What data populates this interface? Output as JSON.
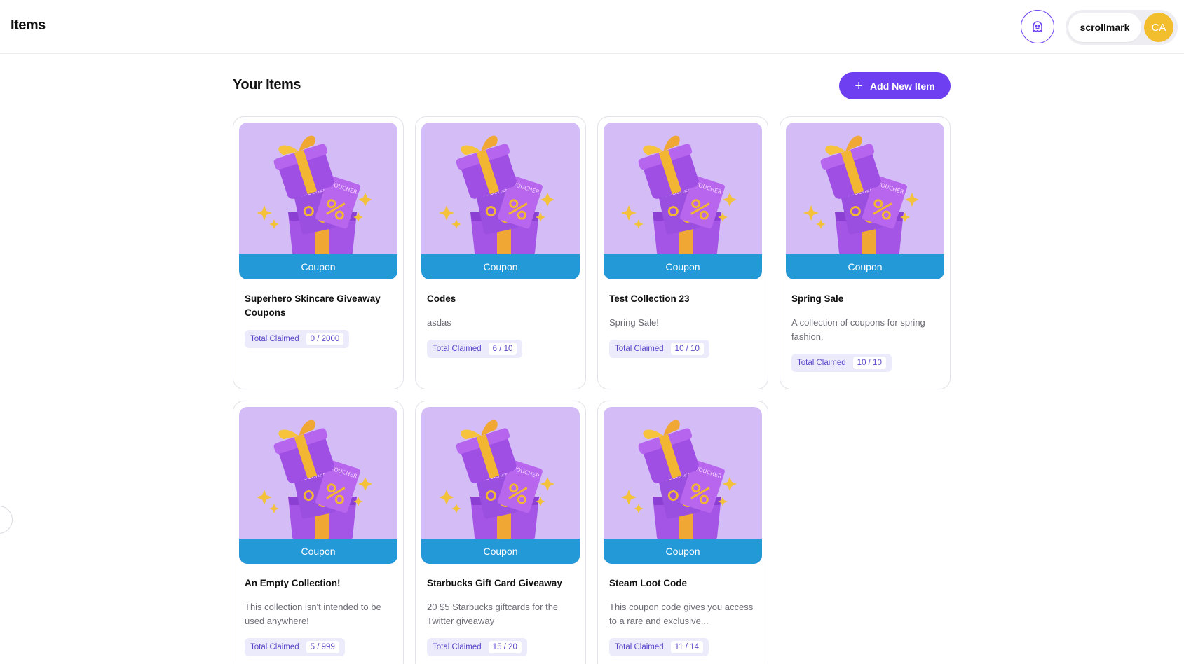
{
  "header": {
    "title": "Items",
    "user_name": "scrollmark",
    "avatar_initials": "CA"
  },
  "main": {
    "section_title": "Your Items",
    "add_button_label": "Add New Item"
  },
  "items": [
    {
      "type": "Coupon",
      "title": "Superhero Skincare Giveaway Coupons",
      "description": "",
      "claimed_label": "Total Claimed",
      "claimed": "0 / 2000"
    },
    {
      "type": "Coupon",
      "title": "Codes",
      "description": "asdas",
      "claimed_label": "Total Claimed",
      "claimed": "6 / 10"
    },
    {
      "type": "Coupon",
      "title": "Test Collection 23",
      "description": "Spring Sale!",
      "claimed_label": "Total Claimed",
      "claimed": "10 / 10"
    },
    {
      "type": "Coupon",
      "title": "Spring Sale",
      "description": "A collection of coupons for spring fashion.",
      "claimed_label": "Total Claimed",
      "claimed": "10 / 10"
    },
    {
      "type": "Coupon",
      "title": "An Empty Collection!",
      "description": "This collection isn't intended to be used anywhere!",
      "claimed_label": "Total Claimed",
      "claimed": "5 / 999"
    },
    {
      "type": "Coupon",
      "title": "Starbucks Gift Card Giveaway",
      "description": "20 $5 Starbucks giftcards for the Twitter giveaway",
      "claimed_label": "Total Claimed",
      "claimed": "15 / 20"
    },
    {
      "type": "Coupon",
      "title": "Steam Loot Code",
      "description": "This coupon code gives you access to a rare and exclusive...",
      "claimed_label": "Total Claimed",
      "claimed": "11 / 14"
    }
  ],
  "colors": {
    "accent": "#6d3ff0",
    "coupon_banner": "#2399d8",
    "avatar": "#f2be2e",
    "media_bg": "#d4bdf7"
  },
  "icons": {
    "ghost_button": "ghost-icon",
    "add_button": "plus-icon",
    "side_handle": "drag-handle-icon"
  }
}
